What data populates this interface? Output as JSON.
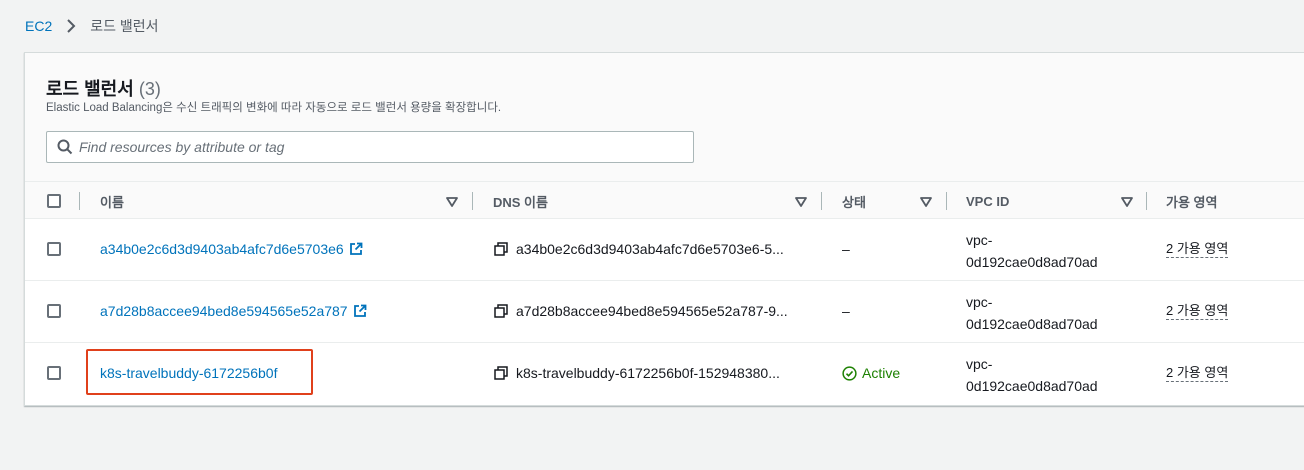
{
  "breadcrumb": {
    "root": "EC2",
    "current": "로드 밸런서"
  },
  "panel": {
    "title": "로드 밸런서",
    "count": "(3)",
    "description": "Elastic Load Balancing은 수신 트래픽의 변화에 따라 자동으로 로드 밸런서 용량을 확장합니다."
  },
  "search": {
    "placeholder": "Find resources by attribute or tag",
    "value": ""
  },
  "table": {
    "headers": {
      "name": "이름",
      "dns": "DNS 이름",
      "state": "상태",
      "vpc": "VPC ID",
      "az": "가용 영역"
    },
    "rows": [
      {
        "name": "a34b0e2c6d3d9403ab4afc7d6e5703e6",
        "dns": "a34b0e2c6d3d9403ab4afc7d6e5703e6-5...",
        "state": "–",
        "vpc_line1": "vpc-",
        "vpc_line2": "0d192cae0d8ad70ad",
        "az": "2 가용 영역"
      },
      {
        "name": "a7d28b8accee94bed8e594565e52a787",
        "dns": "a7d28b8accee94bed8e594565e52a787-9...",
        "state": "–",
        "vpc_line1": "vpc-",
        "vpc_line2": "0d192cae0d8ad70ad",
        "az": "2 가용 영역"
      },
      {
        "name": "k8s-travelbuddy-6172256b0f",
        "dns": "k8s-travelbuddy-6172256b0f-152948380...",
        "state": "Active",
        "vpc_line1": "vpc-",
        "vpc_line2": "0d192cae0d8ad70ad",
        "az": "2 가용 영역"
      }
    ]
  },
  "icons": {
    "breadcrumb_sep": "chevron-right-icon",
    "search": "search-icon",
    "sort": "caret-down-icon",
    "external": "external-link-icon",
    "copy": "copy-icon",
    "status_active": "check-circle-icon"
  },
  "colors": {
    "link": "#0073bb",
    "active": "#1d8102",
    "highlight": "#e0401b",
    "background": "#f2f3f3"
  }
}
